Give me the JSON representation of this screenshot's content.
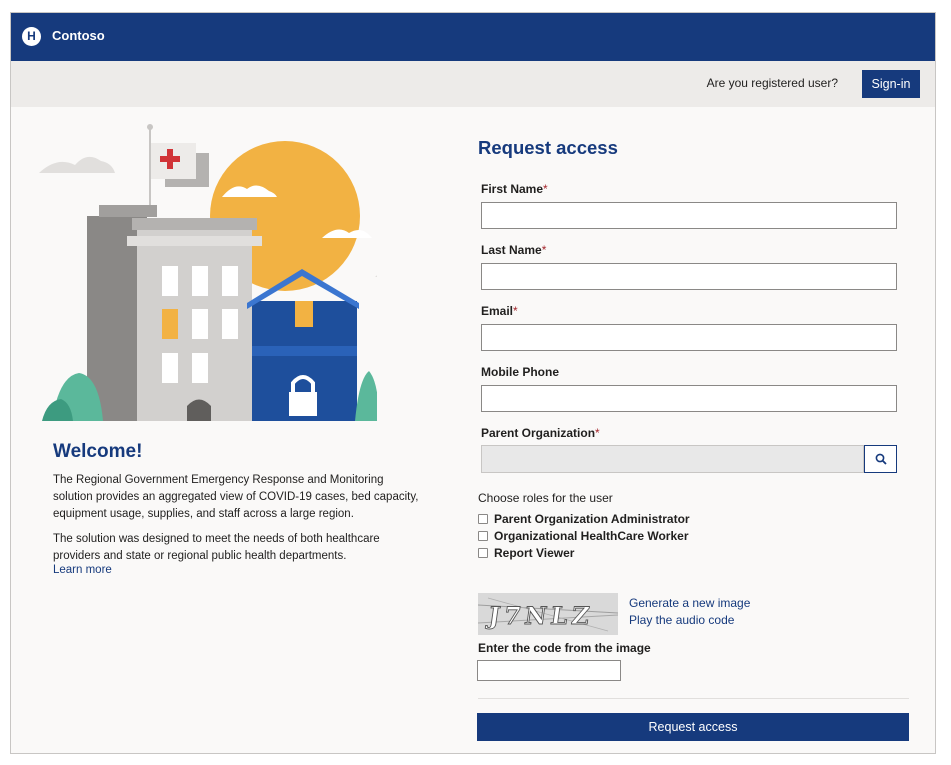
{
  "header": {
    "brand": "Contoso",
    "logo_letter": "H"
  },
  "subbar": {
    "registered_text": "Are you registered user?",
    "signin_label": "Sign-in"
  },
  "intro": {
    "welcome": "Welcome!",
    "paragraph1": "The Regional Government Emergency Response and Monitoring solution provides an aggregated view of COVID-19 cases, bed capacity, equipment usage, supplies, and staff across a large region.",
    "paragraph2": "The solution was designed to meet the needs of both healthcare providers and state or regional public health departments.",
    "learn_more": "Learn more"
  },
  "form": {
    "title": "Request access",
    "required_marker": "*",
    "fields": {
      "first_name": {
        "label": "First Name",
        "value": ""
      },
      "last_name": {
        "label": "Last Name",
        "value": ""
      },
      "email": {
        "label": "Email",
        "value": ""
      },
      "mobile_phone": {
        "label": "Mobile Phone",
        "value": ""
      },
      "parent_org": {
        "label": "Parent Organization",
        "value": ""
      }
    },
    "roles_title": "Choose roles for the user",
    "roles": [
      {
        "label": "Parent Organization Administrator",
        "checked": false
      },
      {
        "label": "Organizational HealthCare Worker",
        "checked": false
      },
      {
        "label": "Report Viewer",
        "checked": false
      }
    ],
    "captcha": {
      "image_text": "J7NLZ",
      "generate_link": "Generate a new image",
      "audio_link": "Play the audio code",
      "code_label": "Enter the code from the image",
      "code_value": ""
    },
    "submit_label": "Request access"
  },
  "icons": {
    "search": "search-icon",
    "logo": "hospital-logo-icon",
    "checkbox": "checkbox-icon"
  },
  "colors": {
    "primary": "#163a7d",
    "required": "#a4262c",
    "page_background": "#faf9f8",
    "subbar_background": "#edebe9"
  }
}
